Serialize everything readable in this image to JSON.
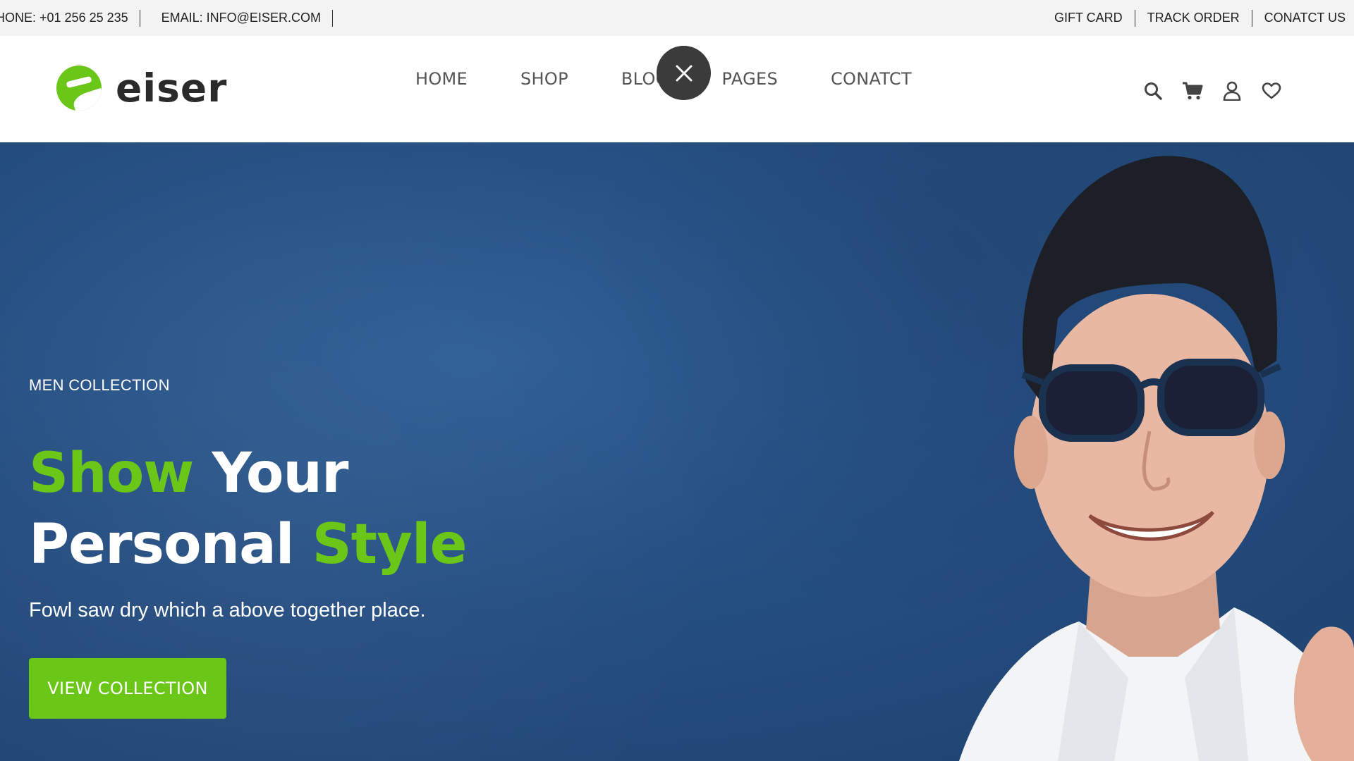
{
  "topbar": {
    "phone": "HONE: +01 256 25 235",
    "email": "EMAIL: INFO@EISER.COM",
    "links": [
      "GIFT CARD",
      "TRACK ORDER",
      "CONATCT US"
    ]
  },
  "header": {
    "logo_text": "eiser",
    "nav": [
      "HOME",
      "SHOP",
      "BLOG",
      "PAGES",
      "CONATCT"
    ],
    "icons": [
      "search-icon",
      "cart-icon",
      "user-icon",
      "heart-icon"
    ]
  },
  "hero": {
    "eyebrow": "MEN COLLECTION",
    "headline": {
      "word1": "Show",
      "word2": "Your",
      "word3": "Personal",
      "word4": "Style"
    },
    "tagline": "Fowl saw dry which a above together place.",
    "cta_label": "VIEW COLLECTION"
  },
  "colors": {
    "accent": "#6ac617",
    "hero_bg": "#254e81",
    "topbar_bg": "#f3f3f3",
    "close_button": "#3b3b3b"
  }
}
